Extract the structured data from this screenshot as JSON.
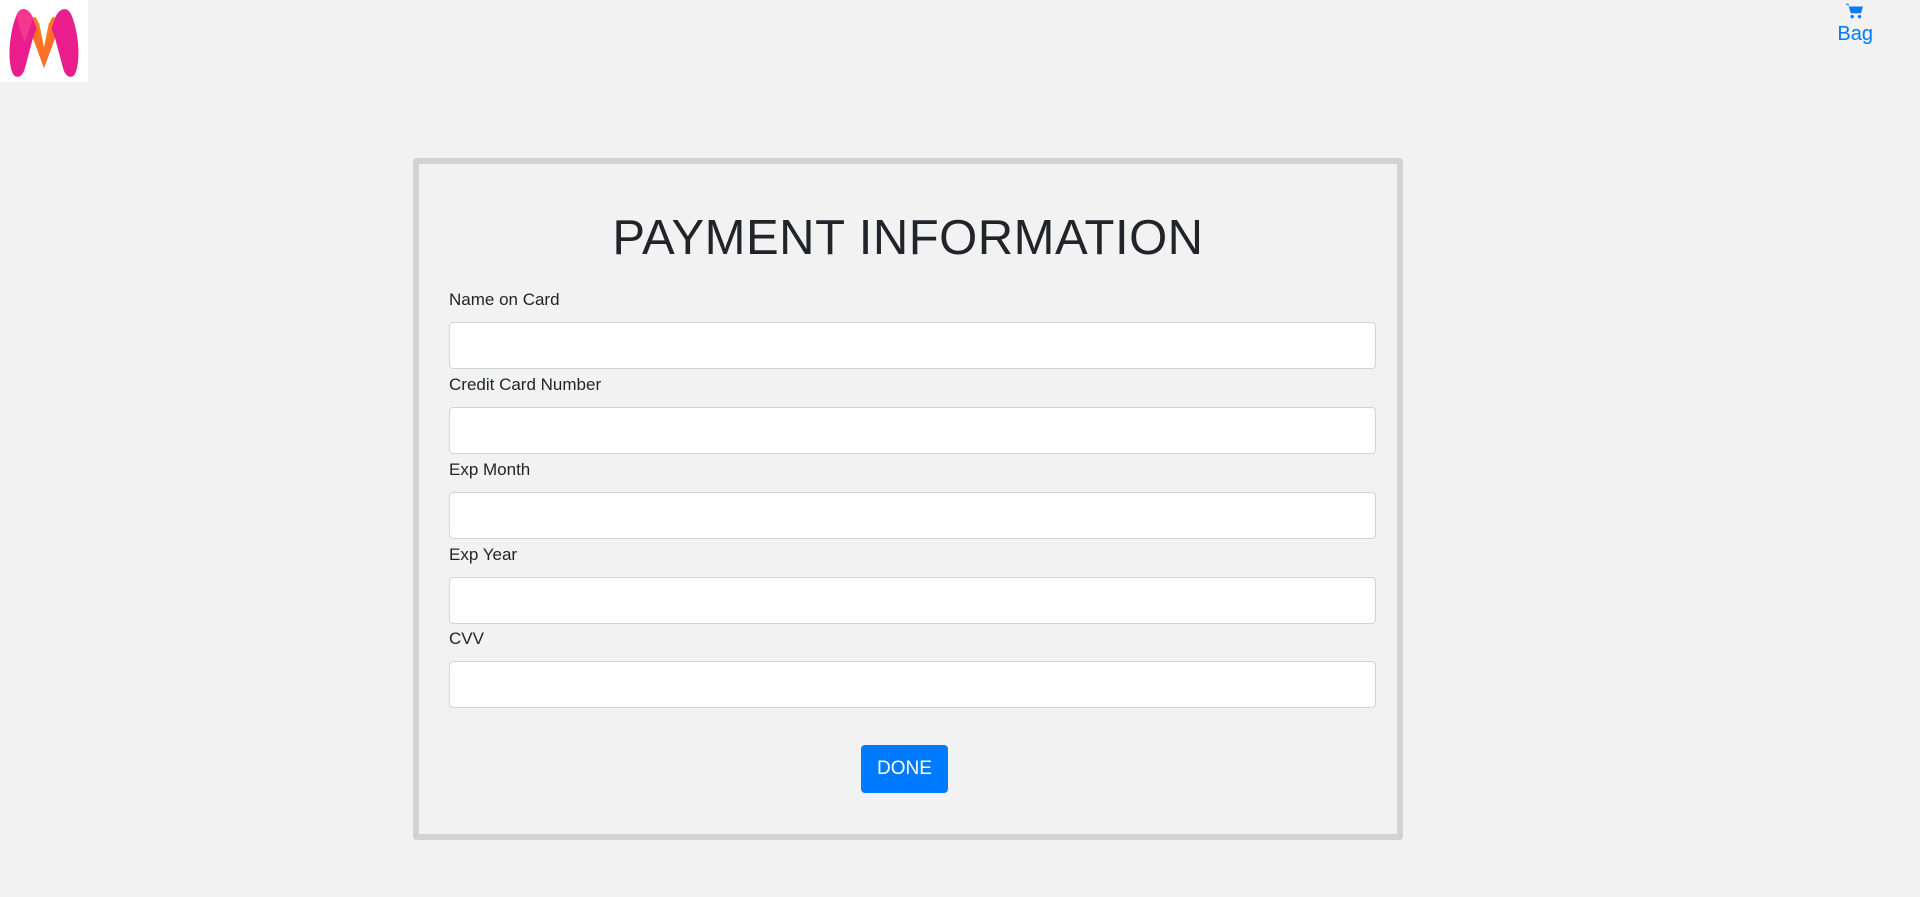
{
  "header": {
    "logo_icon": "myntra-logo",
    "bag_icon": "cart-icon",
    "bag_label": "Bag"
  },
  "payment": {
    "title": "PAYMENT INFORMATION",
    "fields": [
      {
        "label": "Name on Card",
        "value": "",
        "placeholder": ""
      },
      {
        "label": "Credit Card Number",
        "value": "",
        "placeholder": ""
      },
      {
        "label": "Exp Month",
        "value": "",
        "placeholder": ""
      },
      {
        "label": "Exp Year",
        "value": "",
        "placeholder": ""
      },
      {
        "label": "CVV",
        "value": "",
        "placeholder": ""
      }
    ],
    "submit_label": "DONE"
  },
  "colors": {
    "background": "#f2f2f2",
    "accent": "#007bff",
    "card_border": "#d3d3d3",
    "logo_pink": "#e91e8c",
    "logo_orange": "#ff7a1a"
  }
}
